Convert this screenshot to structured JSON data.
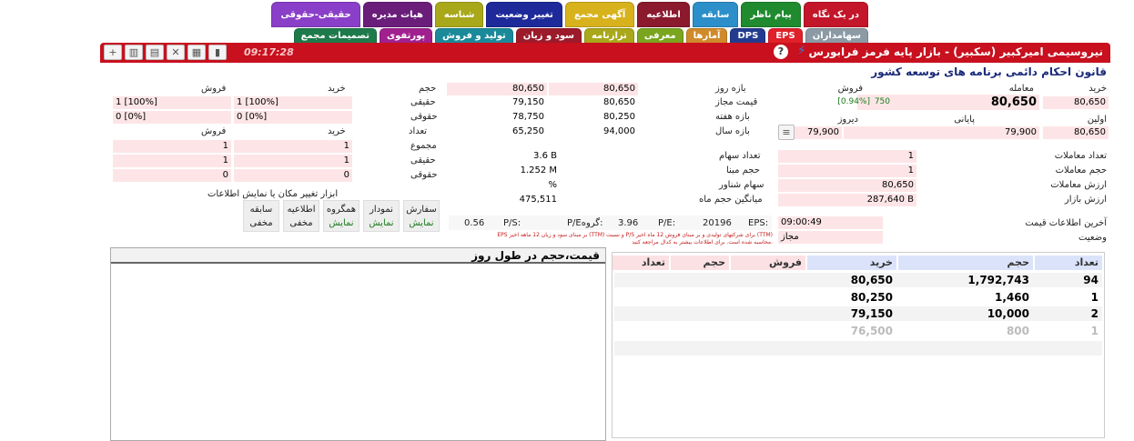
{
  "tabs_row1": [
    "در یک نگاه",
    "پیام ناظر",
    "سابقه",
    "اطلاعیه",
    "آگهی مجمع",
    "تغییر وضعیت",
    "شناسه",
    "هیات مدیره",
    "حقیقی-حقوقی"
  ],
  "tabs_row2": [
    "سهامداران",
    "EPS",
    "DPS",
    "آمارها",
    "معرفی",
    "ترازنامه",
    "سود و زیان",
    "تولید و فروش",
    "پورتفوی",
    "تصمیمات مجمع"
  ],
  "header": {
    "title": "نیروسیمی امیرکبیر (سکبیر) - بازار پایه فرمز فرابورس",
    "clock": "09:17:28",
    "help": "?",
    "bolt": "⚡",
    "subtitle": "قانون احکام دائمی برنامه های توسعه کشور"
  },
  "prices": {
    "buy_hdr": "خرید",
    "deal_hdr": "معامله",
    "sell_hdr": "فروش",
    "buy": "80,650",
    "last": "80,650",
    "change_vol": "750",
    "change_pct": "[0.94%]",
    "sell": "",
    "first_lbl": "اولین",
    "low_lbl": "پایانی",
    "yesterday_lbl": "دیروز",
    "first": "80,650",
    "closing": "79,900",
    "yesterday": "79,900"
  },
  "ranges": {
    "day_lbl": "بازه روز",
    "allowed_lbl": "قیمت مجاز",
    "week_lbl": "بازه هفته",
    "year_lbl": "بازه سال",
    "day": [
      "80,650",
      "80,650"
    ],
    "allowed": [
      "80,650",
      "79,150"
    ],
    "week": [
      "80,250",
      "78,750"
    ],
    "year": [
      "94,000",
      "65,250"
    ]
  },
  "indiv": {
    "vol_lbl": "حجم",
    "buy_lbl": "خرید",
    "sell_lbl": "فروش",
    "real_lbl": "حقیقی",
    "legal_lbl": "حقوقی",
    "count_lbl": "تعداد",
    "real_buy": "1 [100%]",
    "real_sell": "1 [100%]",
    "legal_buy": "0 [0%]",
    "legal_sell": "0 [0%]",
    "cnt_buy_lbl": "خرید",
    "cnt_sell_lbl": "فروش",
    "sum_lbl": "مجموع",
    "sum_buy": "1",
    "sum_sell": "1",
    "real2_lbl": "حقیقی",
    "real2_buy": "1",
    "real2_sell": "1",
    "legal2_lbl": "حقوقی",
    "legal2_buy": "0",
    "legal2_sell": "0"
  },
  "stats_left": {
    "trades_lbl": "تعداد معاملات",
    "trades": "1",
    "volume_lbl": "حجم معاملات",
    "volume": "1",
    "value_lbl": "ارزش معاملات",
    "value": "80,650",
    "mcap_lbl": "ارزش بازار",
    "mcap": "287,640 B",
    "last_info_lbl": "آخرین اطلاعات قیمت",
    "last_info": "09:00:49",
    "status_lbl": "وضعیت",
    "status": "مجاز"
  },
  "stats_mid": {
    "shares_lbl": "تعداد سهام",
    "shares": "3.6 B",
    "base_lbl": "حجم مبنا",
    "base": "1.252 M",
    "float_lbl": "سهام شناور",
    "float": "%",
    "avgvol_lbl": "میانگین حجم ماه",
    "avgvol": "475,511"
  },
  "ratios": {
    "eps_lbl": "EPS:",
    "eps": "20196",
    "pe_lbl": "P/E:",
    "pe": "3.96",
    "gpe_lbl": "P/Eگروه:",
    "gpe": "",
    "ps_lbl": "P/S:",
    "ps": "0.56",
    "note1": "EPS بر مبنای سود و زیان 12 ماهه اخیر (TTM) و نسبت P/S برای شرکتهای تولیدی و بر مبنای فروش 12 ماه اخیر (TTM)",
    "note2": "محاسبه شده است. برای اطلاعات بیشتر به کدال مراجعه کنید."
  },
  "tool_settings": {
    "title": "ابزار تغییر مکان یا نمایش اطلاعات",
    "items": [
      {
        "name": "سفارش",
        "state": "نمایش"
      },
      {
        "name": "نمودار",
        "state": "نمایش"
      },
      {
        "name": "همگروه",
        "state": "نمایش"
      },
      {
        "name": "اطلاعیه",
        "state": "مخفی"
      },
      {
        "name": "سابقه",
        "state": "مخفی"
      }
    ]
  },
  "chart_panel": {
    "title": "قیمت،حجم در طول روز"
  },
  "order_book": {
    "headers": [
      "تعداد",
      "حجم",
      "خرید",
      "فروش",
      "حجم",
      "تعداد"
    ],
    "rows": [
      {
        "count": "94",
        "vol": "1,792,743",
        "price": "80,650"
      },
      {
        "count": "1",
        "vol": "1,460",
        "price": "80,250"
      },
      {
        "count": "2",
        "vol": "10,000",
        "price": "79,150"
      },
      {
        "count": "1",
        "vol": "800",
        "price": "76,500"
      }
    ]
  },
  "colors": {
    "header_red": "#c8101e",
    "buy_bg": "#dbe3fb",
    "sell_bg": "#fbe1e3",
    "cell_pink": "#fde5e7"
  }
}
